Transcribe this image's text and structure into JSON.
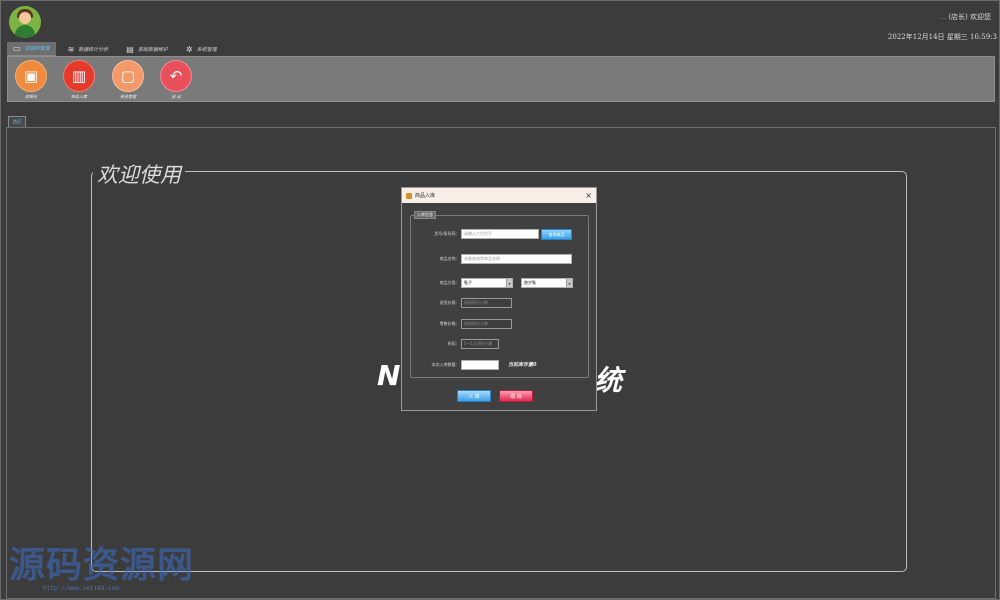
{
  "header": {
    "user_prefix": "...",
    "user_role": "(店长) 欢迎您",
    "datetime": "2022年12月14日 星期三 16:59:3"
  },
  "menu_tabs": [
    {
      "label": "进销存管理",
      "icon": "monitor-icon",
      "active": true
    },
    {
      "label": "数据统计分析",
      "icon": "layers-icon",
      "active": false
    },
    {
      "label": "基础数据维护",
      "icon": "document-icon",
      "active": false
    },
    {
      "label": "系统管理",
      "icon": "gear-icon",
      "active": false
    }
  ],
  "toolbar": {
    "items": [
      {
        "label": "收银台",
        "icon": "cashier-icon",
        "color": "#f08a3c"
      },
      {
        "label": "商品入库",
        "icon": "clipboard-icon",
        "color": "#e53b2c"
      },
      {
        "label": "会员管理",
        "icon": "member-card-icon",
        "color": "#f49a6a"
      },
      {
        "label": "退 出",
        "icon": "undo-icon",
        "color": "#e8505b"
      }
    ]
  },
  "page_tab": "首页",
  "welcome": {
    "title": "欢迎使用",
    "big_left": "N",
    "big_right": "统"
  },
  "dialog": {
    "title": "商品入库",
    "close": "×",
    "group_legend": "入库信息",
    "fields": {
      "barcode": {
        "label": "货号/条形码:",
        "placeholder": "请输入六位货号",
        "button": "查询商品"
      },
      "name": {
        "label": "商品名称:",
        "placeholder": "未能查询到商品名称"
      },
      "category": {
        "label": "商品分类:",
        "value1": "鞋子",
        "value2": "跑步鞋"
      },
      "purchase_price": {
        "label": "进货价格:",
        "placeholder": "保留两位小数"
      },
      "retail_price": {
        "label": "零售价格:",
        "placeholder": "保留两位小数"
      },
      "discount": {
        "label": "折扣:",
        "placeholder": "0~1之间的小数"
      },
      "quantity": {
        "label": "本次入库数量:",
        "value": "",
        "stock_text": "当前库存量0"
      }
    },
    "ok_label": "入 库",
    "cancel_label": "取 消"
  },
  "watermark": {
    "text": "源码资源网",
    "url": "http://www.net188.com"
  }
}
